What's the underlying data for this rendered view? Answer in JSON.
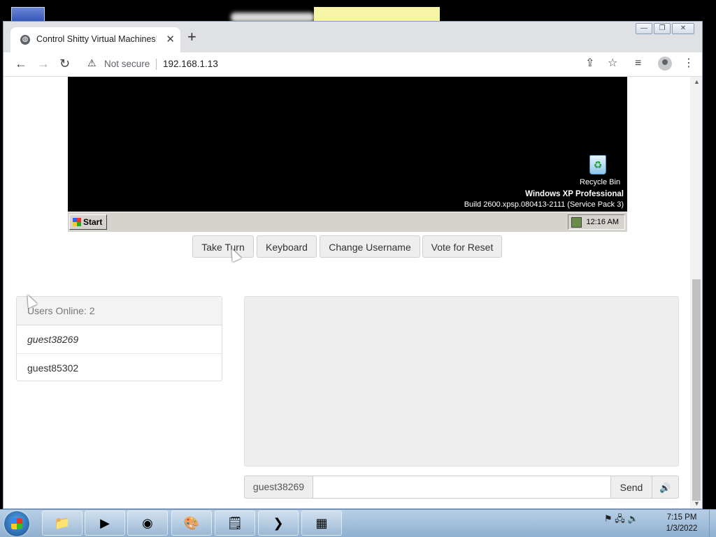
{
  "browser": {
    "tab_title": "Control Shitty Virtual Machines!",
    "tab_close": "✕",
    "new_tab": "+",
    "security_label": "Not secure",
    "url": "192.168.1.13"
  },
  "vm": {
    "recycle_bin_label": "Recycle Bin",
    "os_title": "Windows XP Professional",
    "os_build": "Build 2600.xpsp.080413-2111 (Service Pack 3)",
    "start_label": "Start",
    "clock": "12:16 AM"
  },
  "controls": {
    "take_turn": "Take Turn",
    "keyboard": "Keyboard",
    "change_username": "Change Username",
    "vote_reset": "Vote for Reset"
  },
  "users": {
    "header": "Users Online: 2",
    "list": [
      "guest38269",
      "guest85302"
    ]
  },
  "chat": {
    "username": "guest38269",
    "message_value": "",
    "send_label": "Send",
    "sound_icon": "🔊"
  },
  "taskbar": {
    "time": "7:15 PM",
    "date": "1/3/2022"
  },
  "colors": {
    "vm_screen": "#000000",
    "button_bg": "#eeeeee",
    "chat_bg": "#eeeeee"
  }
}
